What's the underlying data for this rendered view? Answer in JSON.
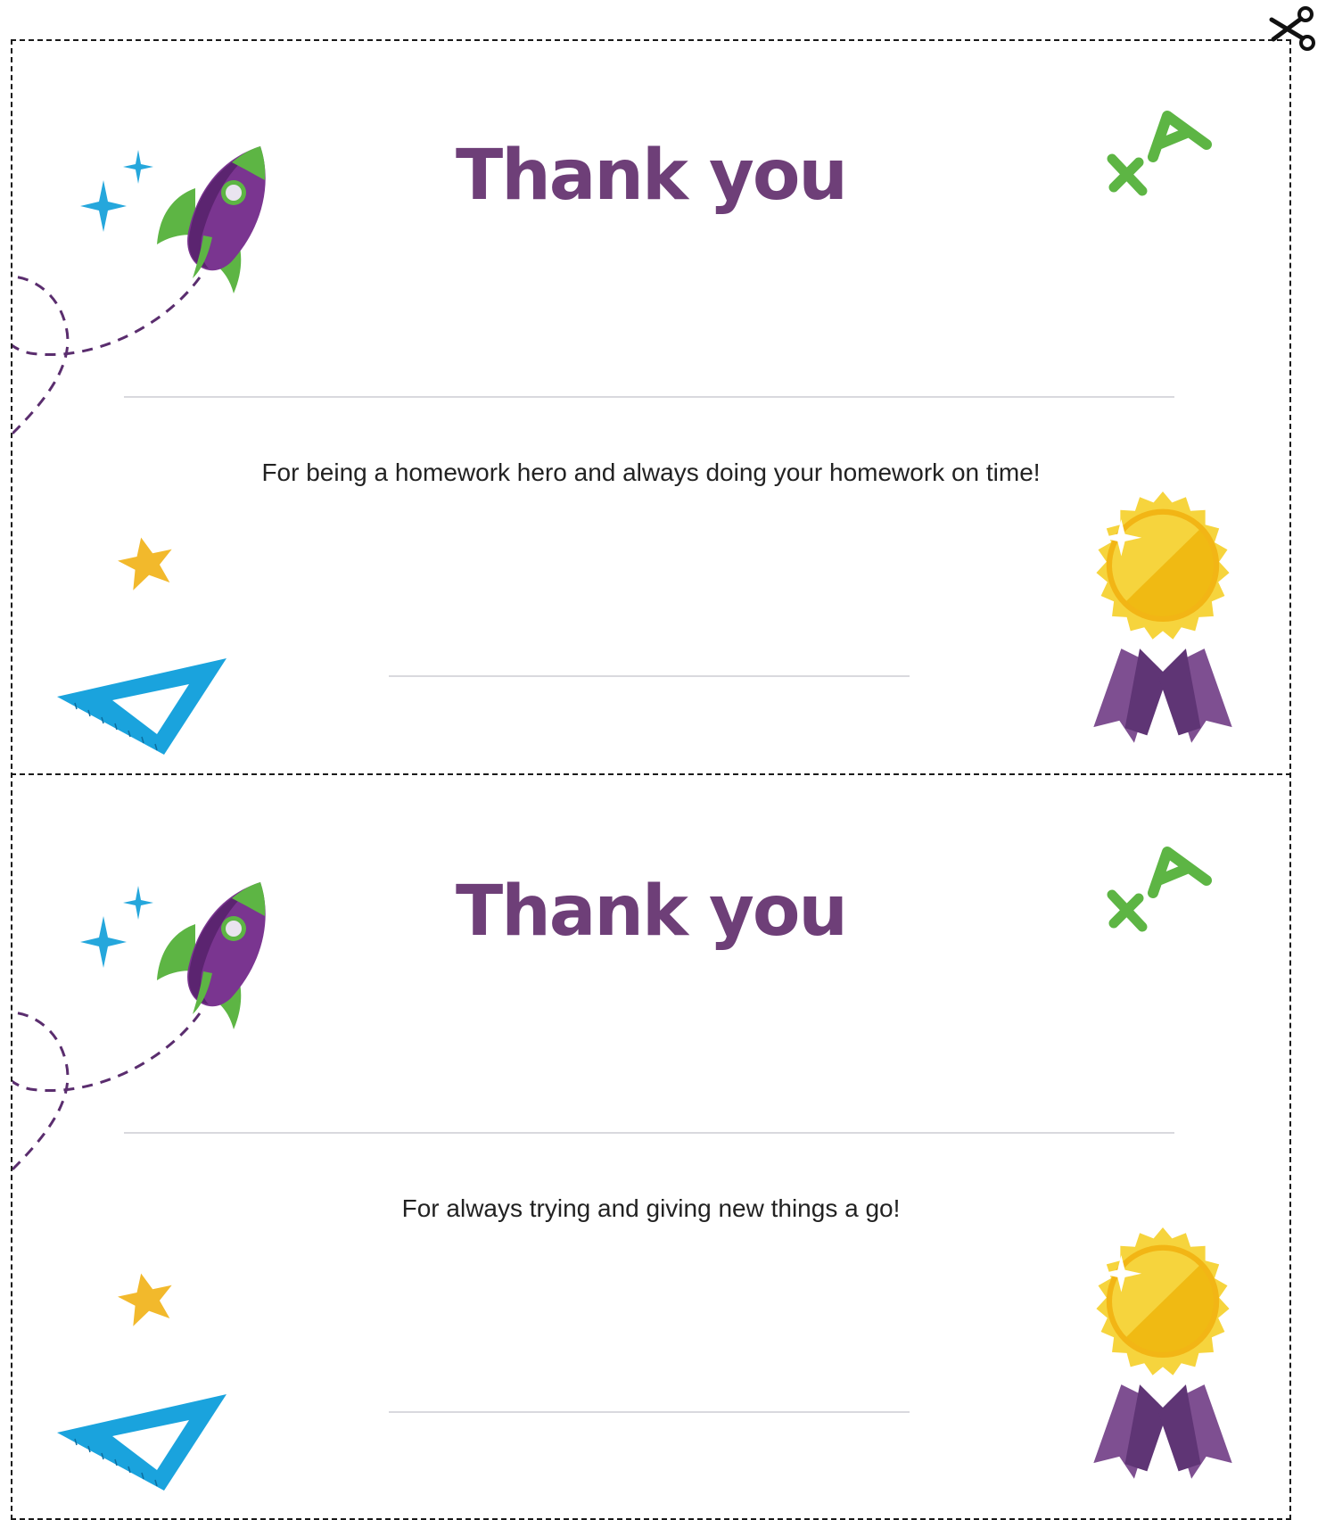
{
  "document": {
    "cards": [
      {
        "title": "Thank you",
        "message": "For being a homework hero and always doing your homework on time!"
      },
      {
        "title": "Thank you",
        "message": "For always trying and giving new things a go!"
      }
    ]
  },
  "decorations": {
    "cut_marker": "scissors-icon",
    "card_art": [
      "rocket-icon",
      "sparkle-icon",
      "plus-a-icon",
      "star-icon",
      "set-square-icon",
      "award-medal-icon"
    ]
  },
  "colors": {
    "title": "#6e3f78",
    "message": "#222222",
    "rule_lines": "#d9d9de",
    "rocket_purple": "#7a3590",
    "rocket_green": "#5db544",
    "sparkle_blue": "#25a7dc",
    "set_square_blue": "#1aa3dd",
    "star_gold": "#f2b92c",
    "medal_gold": "#f4c31a",
    "ribbon_purple": "#6e4187"
  }
}
